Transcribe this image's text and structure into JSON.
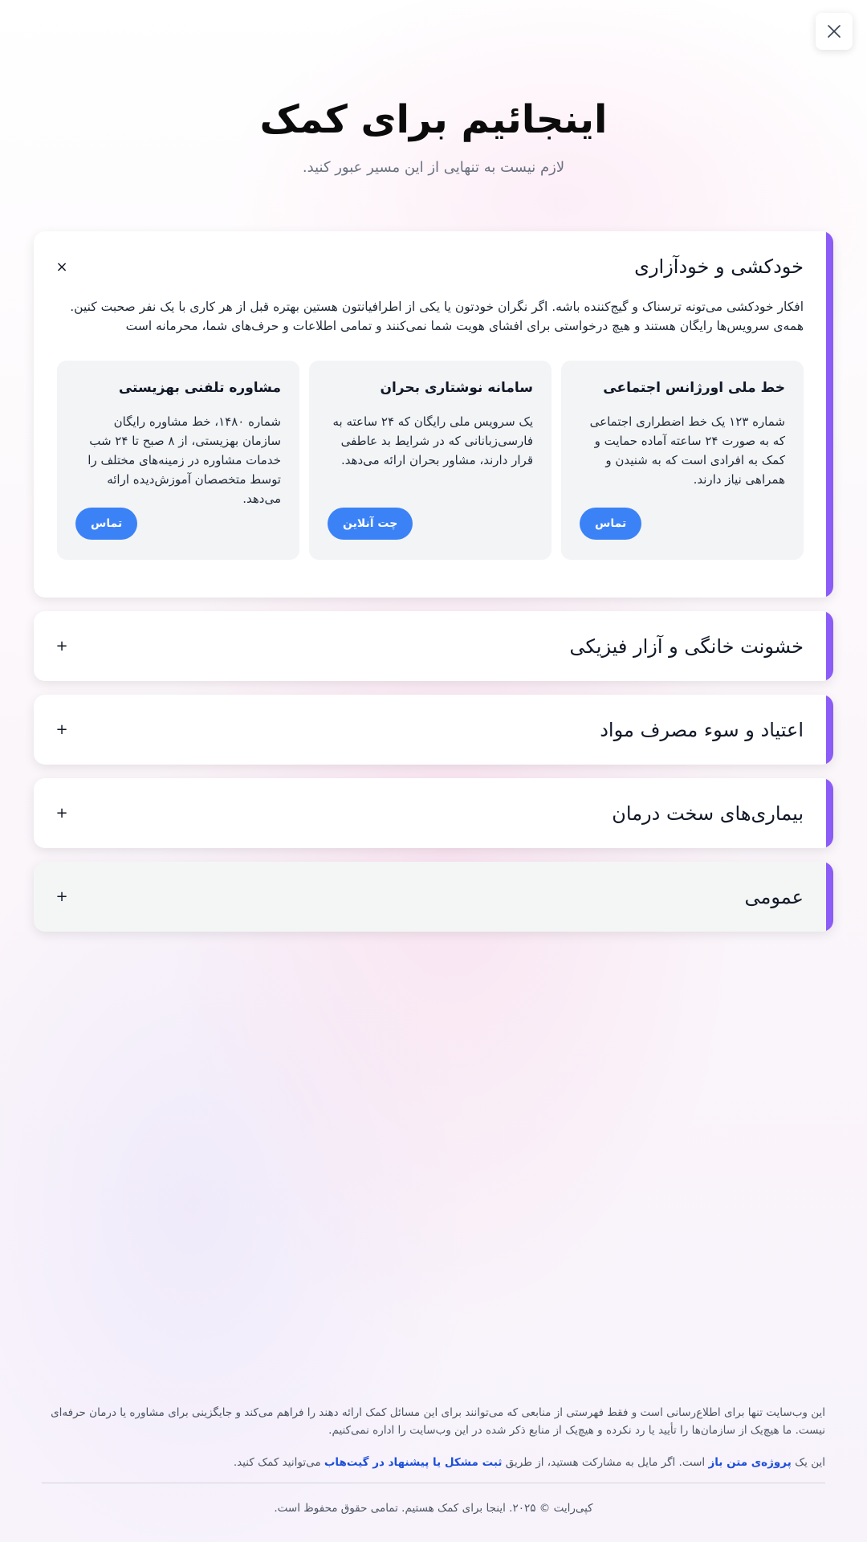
{
  "header": {
    "title": "اینجائیم برای کمک",
    "subtitle": "لازم نیست به تنهایی از این مسیر عبور کنید."
  },
  "close_icon": "close-x-icon",
  "colors": {
    "accent": "#8b5cf6",
    "button": "#3b82f6",
    "link": "#1d4ed8"
  },
  "sections": [
    {
      "title": "خودکشی و خودآزاری",
      "toggle": "×",
      "expanded": true,
      "description": "افکار خودکشی می‌تونه ترسناک و گیج‌کننده باشه. اگر نگران خودتون یا یکی از اطرافیانتون هستین بهتره قبل از هر کاری با یک نفر صحبت کنین. همه‌ی سرویس‌ها رایگان هستند و هیچ درخواستی برای افشای هویت شما نمی‌کنند و تمامی اطلاعات و حرف‌های شما، محرمانه است",
      "resources": [
        {
          "title": "خط ملی اورژانس اجتماعی",
          "description": "شماره ۱۲۳ یک خط اضطراری اجتماعی که به صورت ۲۴ ساعته آماده حمایت و کمک به افرادی است که به شنیدن و همراهی نیاز دارند.",
          "button": "تماس"
        },
        {
          "title": "سامانه نوشتاری بحران",
          "description": "یک سرویس ملی رایگان که ۲۴ ساعته به فارسی‌زبانانی که در شرایط بد عاطفی قرار دارند، مشاور بحران ارائه می‌دهد.",
          "button": "چت آنلاین"
        },
        {
          "title": "مشاوره تلفنی بهزیستی",
          "description": "شماره ۱۴۸۰، خط مشاوره رایگان سازمان بهزیستی، از ۸ صبح تا ۲۴ شب خدمات مشاوره در زمینه‌های مختلف را توسط متخصصان آموزش‌دیده ارائه می‌دهد.",
          "button": "تماس"
        }
      ]
    },
    {
      "title": "خشونت خانگی و آزار فیزیکی",
      "toggle": "+"
    },
    {
      "title": "اعتیاد و سوء مصرف مواد",
      "toggle": "+"
    },
    {
      "title": "بیماری‌های سخت درمان",
      "toggle": "+"
    },
    {
      "title": "عمومی",
      "toggle": "+"
    }
  ],
  "footer": {
    "disclaimer": "این وب‌سایت تنها برای اطلاع‌رسانی است و فقط فهرستی از منابعی که می‌توانند برای این مسائل کمک ارائه دهند را فراهم می‌کند و جایگزینی برای مشاوره یا درمان حرفه‌ای نیست. ما هیچ‌یک از سازمان‌ها را تأیید یا رد نکرده و هیچ‌یک از منابع ذکر شده در این وب‌سایت را اداره نمی‌کنیم.",
    "oss_prefix": "این یک",
    "oss_link": "پروژه‌ی متن باز",
    "oss_middle": "است. اگر مایل به مشارکت هستید، از طریق",
    "github_link": "ثبت مشکل یا پیشنهاد در گیت‌هاب",
    "oss_suffix": "می‌توانید کمک کنید.",
    "copyright": "کپی‌رایت © ۲۰۲۵. اینجا برای کمک هستیم. تمامی حقوق محفوظ است."
  }
}
